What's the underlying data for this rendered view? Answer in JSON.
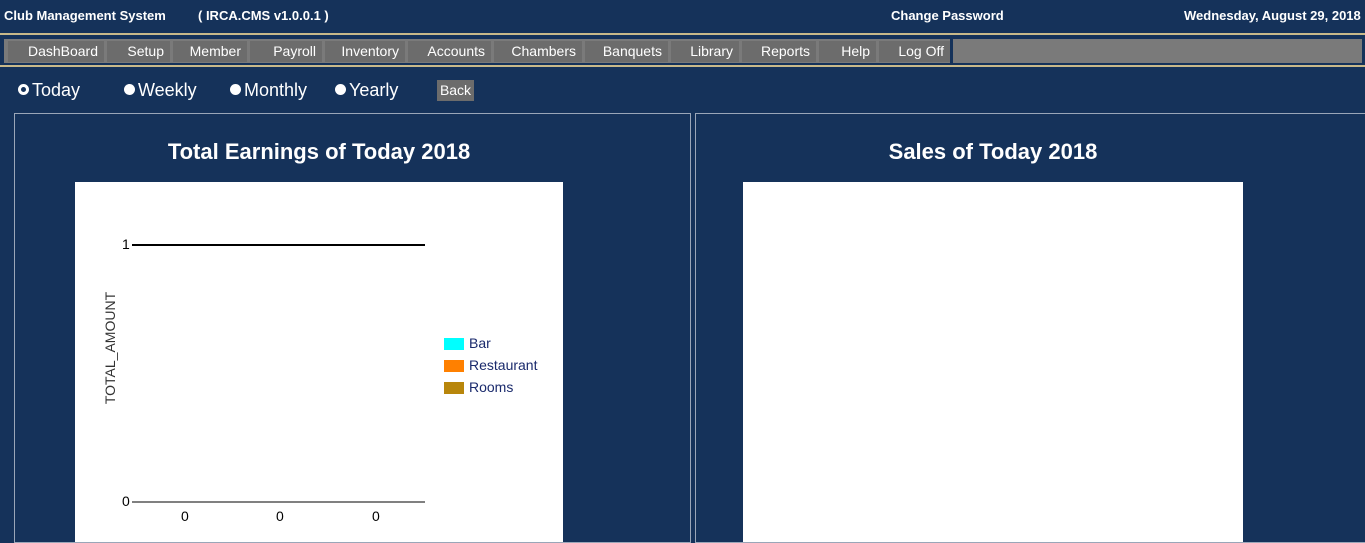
{
  "header": {
    "app_name": "Club Management System",
    "version": "( IRCA.CMS v1.0.0.1 )",
    "change_password": "Change Password",
    "date": "Wednesday, August 29, 2018"
  },
  "menu": {
    "items": [
      "DashBoard",
      "Setup",
      "Member",
      "Payroll",
      "Inventory",
      "Accounts",
      "Chambers",
      "Banquets",
      "Library",
      "Reports",
      "Help",
      "Log Off"
    ]
  },
  "period": {
    "options": [
      "Today",
      "Weekly",
      "Monthly",
      "Yearly"
    ],
    "selected": "Today",
    "back_label": "Back"
  },
  "panels": {
    "earnings_title": "Total Earnings of Today 2018",
    "sales_title": "Sales of Today 2018"
  },
  "chart_data": {
    "type": "bar",
    "title": "Total Earnings of Today 2018",
    "ylabel": "TOTAL_AMOUNT",
    "xlabel": "",
    "categories": [
      "0",
      "0",
      "0"
    ],
    "series": [
      {
        "name": "Bar",
        "color": "#00ffff",
        "values": [
          0,
          0,
          0
        ]
      },
      {
        "name": "Restaurant",
        "color": "#ff8000",
        "values": [
          0,
          0,
          0
        ]
      },
      {
        "name": "Rooms",
        "color": "#b8860b",
        "values": [
          0,
          0,
          0
        ]
      }
    ],
    "y_ticks": [
      "1",
      "0"
    ],
    "ylim": [
      0,
      1
    ],
    "legend": "right"
  }
}
